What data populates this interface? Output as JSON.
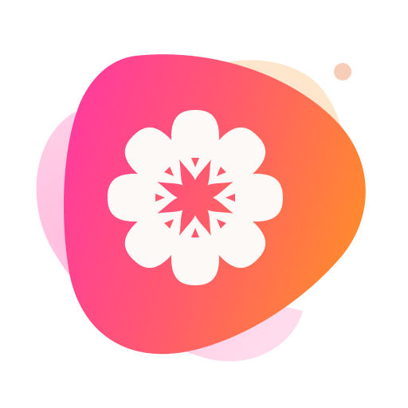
{
  "app_icon": {
    "icon_name": "citrus-flower-logo-icon",
    "colors": {
      "background": "#ffffff",
      "blob_gradient_start": "#ff3d9a",
      "blob_gradient_mid": "#ff5a6e",
      "blob_gradient_end": "#ff8c2a",
      "back_blob_pink": "#ffc3e0",
      "back_blob_peach": "#fde3c6",
      "accent_dot": "#f8cdb8",
      "petal_fill": "#fdf9f6"
    }
  }
}
